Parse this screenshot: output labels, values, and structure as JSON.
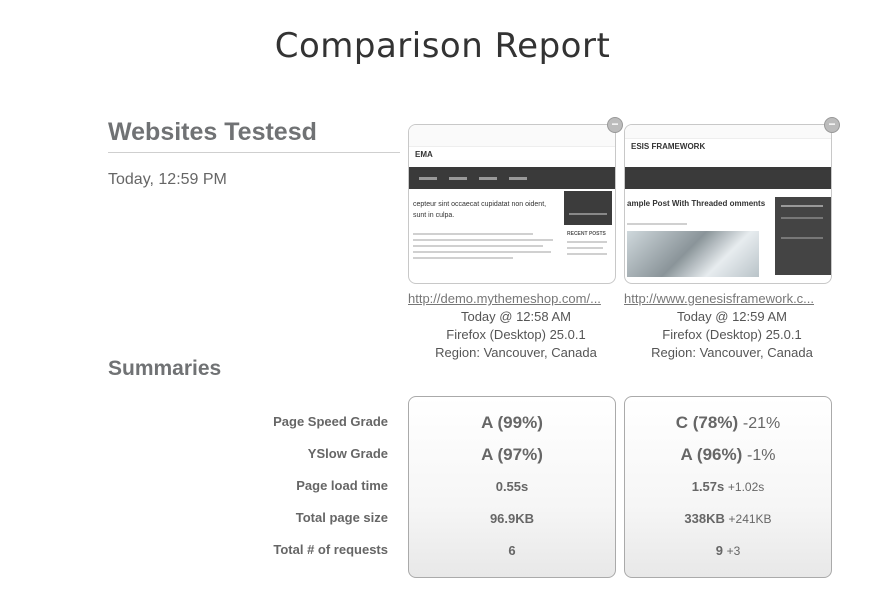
{
  "report": {
    "title": "Comparison Report"
  },
  "websites": {
    "heading": "Websites Testesd",
    "tested_at": "Today, 12:59 PM",
    "sites": [
      {
        "url": "http://demo.mythemeshop.com/...",
        "time": "Today @ 12:58 AM",
        "browser": "Firefox (Desktop) 25.0.1",
        "region": "Region: Vancouver, Canada",
        "thumb": {
          "brand": "EMA",
          "headline": "cepteur sint occaecat cupidatat non oident, sunt in culpa.",
          "sidebar_title": "RECENT POSTS"
        }
      },
      {
        "url": "http://www.genesisframework.c...",
        "time": "Today @ 12:59 AM",
        "browser": "Firefox (Desktop) 25.0.1",
        "region": "Region: Vancouver, Canada",
        "thumb": {
          "brand": "ESIS FRAMEWORK",
          "headline": "ample Post With Threaded omments"
        }
      }
    ]
  },
  "summaries": {
    "heading": "Summaries",
    "metrics": [
      "Page Speed Grade",
      "YSlow Grade",
      "Page load time",
      "Total page size",
      "Total # of requests"
    ],
    "results": [
      [
        {
          "value": "A (99%)",
          "delta": ""
        },
        {
          "value": "A (97%)",
          "delta": ""
        },
        {
          "value": "0.55s",
          "delta": ""
        },
        {
          "value": "96.9KB",
          "delta": ""
        },
        {
          "value": "6",
          "delta": ""
        }
      ],
      [
        {
          "value": "C (78%)",
          "delta": "-21%"
        },
        {
          "value": "A (96%)",
          "delta": "-1%"
        },
        {
          "value": "1.57s",
          "delta": "+1.02s"
        },
        {
          "value": "338KB",
          "delta": "+241KB"
        },
        {
          "value": "9",
          "delta": "+3"
        }
      ]
    ]
  },
  "colors": {
    "heading": "#707274",
    "title": "#333333",
    "nav_dark": "#3a3a3a"
  },
  "icons": {
    "remove": "minus-circle-icon"
  }
}
